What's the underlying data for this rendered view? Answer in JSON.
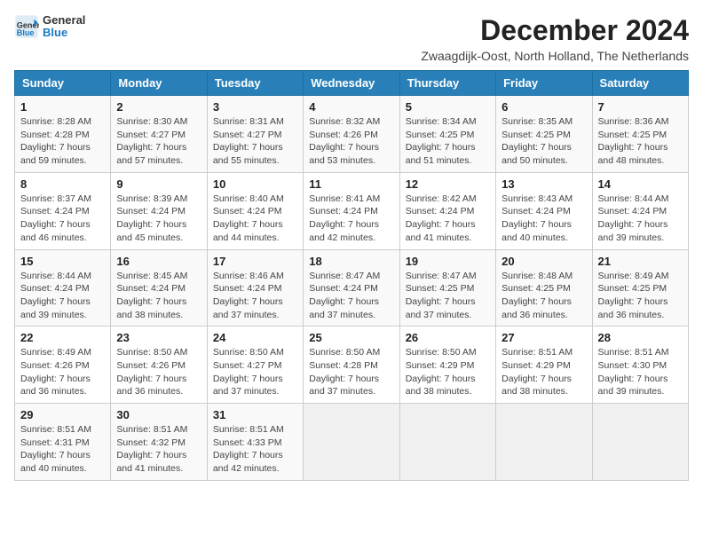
{
  "header": {
    "logo": {
      "line1": "General",
      "line2": "Blue"
    },
    "title": "December 2024",
    "location": "Zwaagdijk-Oost, North Holland, The Netherlands"
  },
  "weekdays": [
    "Sunday",
    "Monday",
    "Tuesday",
    "Wednesday",
    "Thursday",
    "Friday",
    "Saturday"
  ],
  "weeks": [
    [
      {
        "day": "1",
        "sunrise": "8:28 AM",
        "sunset": "4:28 PM",
        "daylight": "7 hours and 59 minutes."
      },
      {
        "day": "2",
        "sunrise": "8:30 AM",
        "sunset": "4:27 PM",
        "daylight": "7 hours and 57 minutes."
      },
      {
        "day": "3",
        "sunrise": "8:31 AM",
        "sunset": "4:27 PM",
        "daylight": "7 hours and 55 minutes."
      },
      {
        "day": "4",
        "sunrise": "8:32 AM",
        "sunset": "4:26 PM",
        "daylight": "7 hours and 53 minutes."
      },
      {
        "day": "5",
        "sunrise": "8:34 AM",
        "sunset": "4:25 PM",
        "daylight": "7 hours and 51 minutes."
      },
      {
        "day": "6",
        "sunrise": "8:35 AM",
        "sunset": "4:25 PM",
        "daylight": "7 hours and 50 minutes."
      },
      {
        "day": "7",
        "sunrise": "8:36 AM",
        "sunset": "4:25 PM",
        "daylight": "7 hours and 48 minutes."
      }
    ],
    [
      {
        "day": "8",
        "sunrise": "8:37 AM",
        "sunset": "4:24 PM",
        "daylight": "7 hours and 46 minutes."
      },
      {
        "day": "9",
        "sunrise": "8:39 AM",
        "sunset": "4:24 PM",
        "daylight": "7 hours and 45 minutes."
      },
      {
        "day": "10",
        "sunrise": "8:40 AM",
        "sunset": "4:24 PM",
        "daylight": "7 hours and 44 minutes."
      },
      {
        "day": "11",
        "sunrise": "8:41 AM",
        "sunset": "4:24 PM",
        "daylight": "7 hours and 42 minutes."
      },
      {
        "day": "12",
        "sunrise": "8:42 AM",
        "sunset": "4:24 PM",
        "daylight": "7 hours and 41 minutes."
      },
      {
        "day": "13",
        "sunrise": "8:43 AM",
        "sunset": "4:24 PM",
        "daylight": "7 hours and 40 minutes."
      },
      {
        "day": "14",
        "sunrise": "8:44 AM",
        "sunset": "4:24 PM",
        "daylight": "7 hours and 39 minutes."
      }
    ],
    [
      {
        "day": "15",
        "sunrise": "8:44 AM",
        "sunset": "4:24 PM",
        "daylight": "7 hours and 39 minutes."
      },
      {
        "day": "16",
        "sunrise": "8:45 AM",
        "sunset": "4:24 PM",
        "daylight": "7 hours and 38 minutes."
      },
      {
        "day": "17",
        "sunrise": "8:46 AM",
        "sunset": "4:24 PM",
        "daylight": "7 hours and 37 minutes."
      },
      {
        "day": "18",
        "sunrise": "8:47 AM",
        "sunset": "4:24 PM",
        "daylight": "7 hours and 37 minutes."
      },
      {
        "day": "19",
        "sunrise": "8:47 AM",
        "sunset": "4:25 PM",
        "daylight": "7 hours and 37 minutes."
      },
      {
        "day": "20",
        "sunrise": "8:48 AM",
        "sunset": "4:25 PM",
        "daylight": "7 hours and 36 minutes."
      },
      {
        "day": "21",
        "sunrise": "8:49 AM",
        "sunset": "4:25 PM",
        "daylight": "7 hours and 36 minutes."
      }
    ],
    [
      {
        "day": "22",
        "sunrise": "8:49 AM",
        "sunset": "4:26 PM",
        "daylight": "7 hours and 36 minutes."
      },
      {
        "day": "23",
        "sunrise": "8:50 AM",
        "sunset": "4:26 PM",
        "daylight": "7 hours and 36 minutes."
      },
      {
        "day": "24",
        "sunrise": "8:50 AM",
        "sunset": "4:27 PM",
        "daylight": "7 hours and 37 minutes."
      },
      {
        "day": "25",
        "sunrise": "8:50 AM",
        "sunset": "4:28 PM",
        "daylight": "7 hours and 37 minutes."
      },
      {
        "day": "26",
        "sunrise": "8:50 AM",
        "sunset": "4:29 PM",
        "daylight": "7 hours and 38 minutes."
      },
      {
        "day": "27",
        "sunrise": "8:51 AM",
        "sunset": "4:29 PM",
        "daylight": "7 hours and 38 minutes."
      },
      {
        "day": "28",
        "sunrise": "8:51 AM",
        "sunset": "4:30 PM",
        "daylight": "7 hours and 39 minutes."
      }
    ],
    [
      {
        "day": "29",
        "sunrise": "8:51 AM",
        "sunset": "4:31 PM",
        "daylight": "7 hours and 40 minutes."
      },
      {
        "day": "30",
        "sunrise": "8:51 AM",
        "sunset": "4:32 PM",
        "daylight": "7 hours and 41 minutes."
      },
      {
        "day": "31",
        "sunrise": "8:51 AM",
        "sunset": "4:33 PM",
        "daylight": "7 hours and 42 minutes."
      },
      null,
      null,
      null,
      null
    ]
  ]
}
